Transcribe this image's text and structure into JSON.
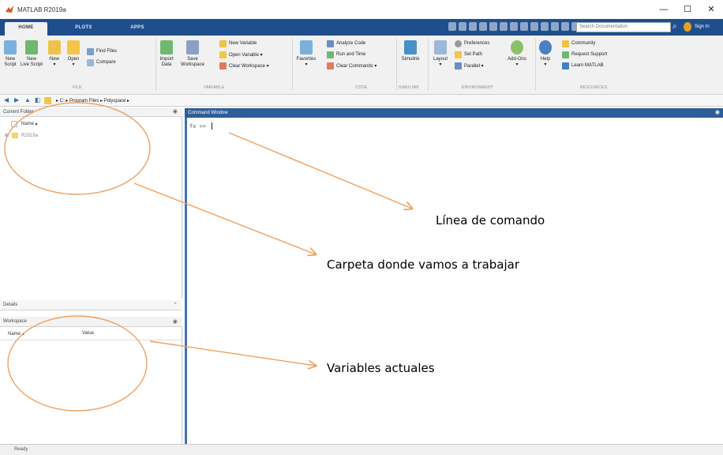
{
  "window": {
    "title": "MATLAB R2019a",
    "controls": [
      "—",
      "☐",
      "✕"
    ]
  },
  "tabs": [
    {
      "label": "HOME",
      "active": true
    },
    {
      "label": "PLOTS",
      "active": false
    },
    {
      "label": "APPS",
      "active": false
    }
  ],
  "search": {
    "placeholder": "Search Documentation",
    "signin": "Sign In"
  },
  "ribbon": {
    "file": {
      "label": "FILE",
      "new_script": [
        "New",
        "Script"
      ],
      "new_live_script": [
        "New",
        "Live Script"
      ],
      "new": [
        "New",
        "▾"
      ],
      "open": [
        "Open",
        "▾"
      ],
      "find_files": "Find Files",
      "compare": "Compare"
    },
    "variable": {
      "label": "VARIABLE",
      "import_data": [
        "Import",
        "Data"
      ],
      "save_workspace": [
        "Save",
        "Workspace"
      ],
      "new_variable": "New Variable",
      "open_variable": "Open Variable ▾",
      "clear_workspace": "Clear Workspace ▾"
    },
    "code": {
      "label": "CODE",
      "favorites": [
        "Favorites",
        "▾"
      ],
      "analyze_code": "Analyze Code",
      "run_and_time": "Run and Time",
      "clear_commands": "Clear Commands ▾"
    },
    "simulink": {
      "label": "SIMULINK",
      "simulink": "Simulink"
    },
    "environment": {
      "label": "ENVIRONMENT",
      "layout": [
        "Layout",
        "▾"
      ],
      "preferences": "Preferences",
      "set_path": "Set Path",
      "parallel": "Parallel ▾",
      "add_ons": [
        "Add-Ons",
        "▾"
      ]
    },
    "resources": {
      "label": "RESOURCES",
      "help": [
        "Help",
        "▾"
      ],
      "community": "Community",
      "request_support": "Request Support",
      "learn_matlab": "Learn MATLAB"
    }
  },
  "address": {
    "path": "▸ C: ▸ Program Files ▸ Polyspace ▸"
  },
  "current_folder": {
    "title": "Current Folder",
    "name_col": "Name ▴",
    "items": [
      "R2019a"
    ]
  },
  "details": {
    "title": "Details",
    "btn": "⌃"
  },
  "workspace": {
    "title": "Workspace",
    "name_col": "Name ▴",
    "value_col": "Value"
  },
  "command_window": {
    "title": "Command Window",
    "prompt": "fx >>"
  },
  "status": {
    "text": "Ready"
  },
  "annotations": {
    "command_line": "Línea de comando",
    "working_folder": "Carpeta donde vamos a trabajar",
    "current_variables": "Variables actuales"
  },
  "colors": {
    "tab_bar": "#1f4e8c",
    "command_header": "#2f5d97",
    "annotation_ellipse": "#f0a060"
  }
}
